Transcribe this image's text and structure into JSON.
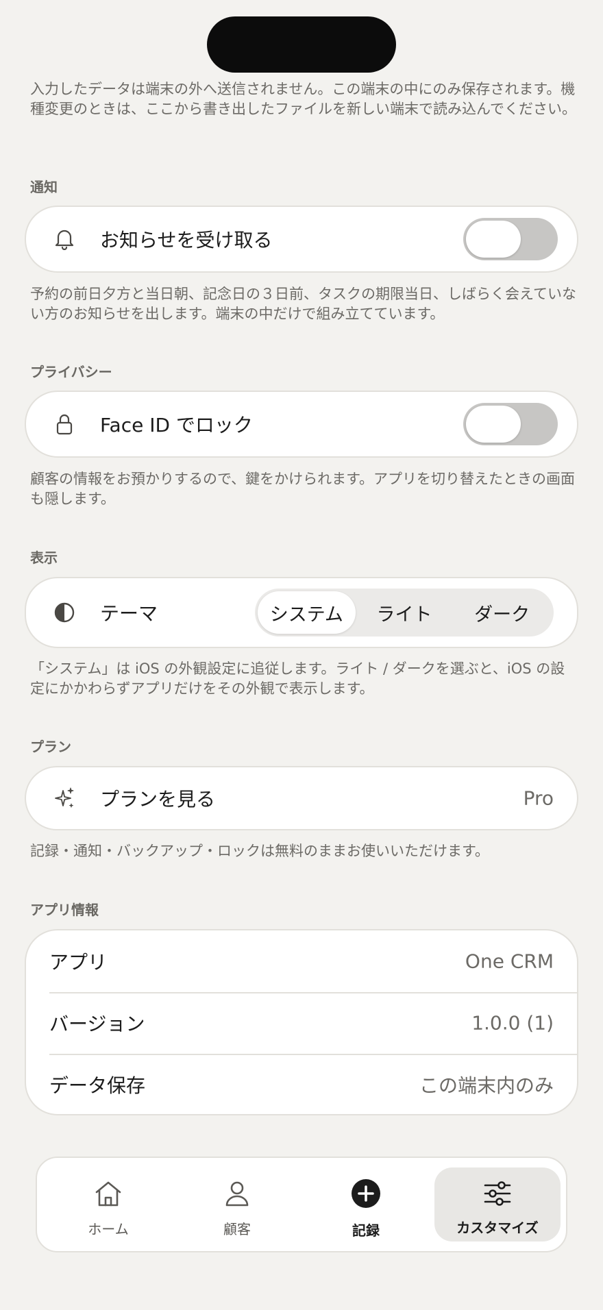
{
  "backup": {
    "note": "入力したデータは端末の外へ送信されません。この端末の中にのみ保存されます。機種変更のときは、ここから書き出したファイルを新しい端末で読み込んでください。"
  },
  "notifications": {
    "section_title": "通知",
    "row_label": "お知らせを受け取る",
    "icon": "bell-icon",
    "toggle_on": false,
    "note": "予約の前日夕方と当日朝、記念日の３日前、タスクの期限当日、しばらく会えていない方のお知らせを出します。端末の中だけで組み立てています。"
  },
  "privacy": {
    "section_title": "プライバシー",
    "row_label": "Face ID でロック",
    "icon": "lock-icon",
    "toggle_on": false,
    "note": "顧客の情報をお預かりするので、鍵をかけられます。アプリを切り替えたときの画面も隠します。"
  },
  "display": {
    "section_title": "表示",
    "row_label": "テーマ",
    "icon": "contrast-icon",
    "options": [
      "システム",
      "ライト",
      "ダーク"
    ],
    "selected": "システム",
    "note": "「システム」は iOS の外観設定に追従します。ライト / ダークを選ぶと、iOS の設定にかかわらずアプリだけをその外観で表示します。"
  },
  "plan": {
    "section_title": "プラン",
    "row_label": "プランを見る",
    "icon": "sparkle-icon",
    "value": "Pro",
    "note": "記録・通知・バックアップ・ロックは無料のままお使いいただけます。"
  },
  "app_info": {
    "section_title": "アプリ情報",
    "rows": [
      {
        "label": "アプリ",
        "value": "One CRM"
      },
      {
        "label": "バージョン",
        "value": "1.0.0 (1)"
      },
      {
        "label": "データ保存",
        "value": "この端末内のみ"
      }
    ]
  },
  "tabbar": {
    "tabs": [
      {
        "label": "ホーム",
        "icon": "home-icon",
        "active": false
      },
      {
        "label": "顧客",
        "icon": "person-icon",
        "active": false
      },
      {
        "label": "記録",
        "icon": "plus-circle-icon",
        "active": false
      },
      {
        "label": "カスタマイズ",
        "icon": "sliders-icon",
        "active": true
      }
    ]
  },
  "colors": {
    "background": "#f3f2ef",
    "card": "#ffffff",
    "toggle_off": "#c7c6c4",
    "secondary_text": "#6c6a66",
    "active_tab": "#e8e7e4"
  }
}
